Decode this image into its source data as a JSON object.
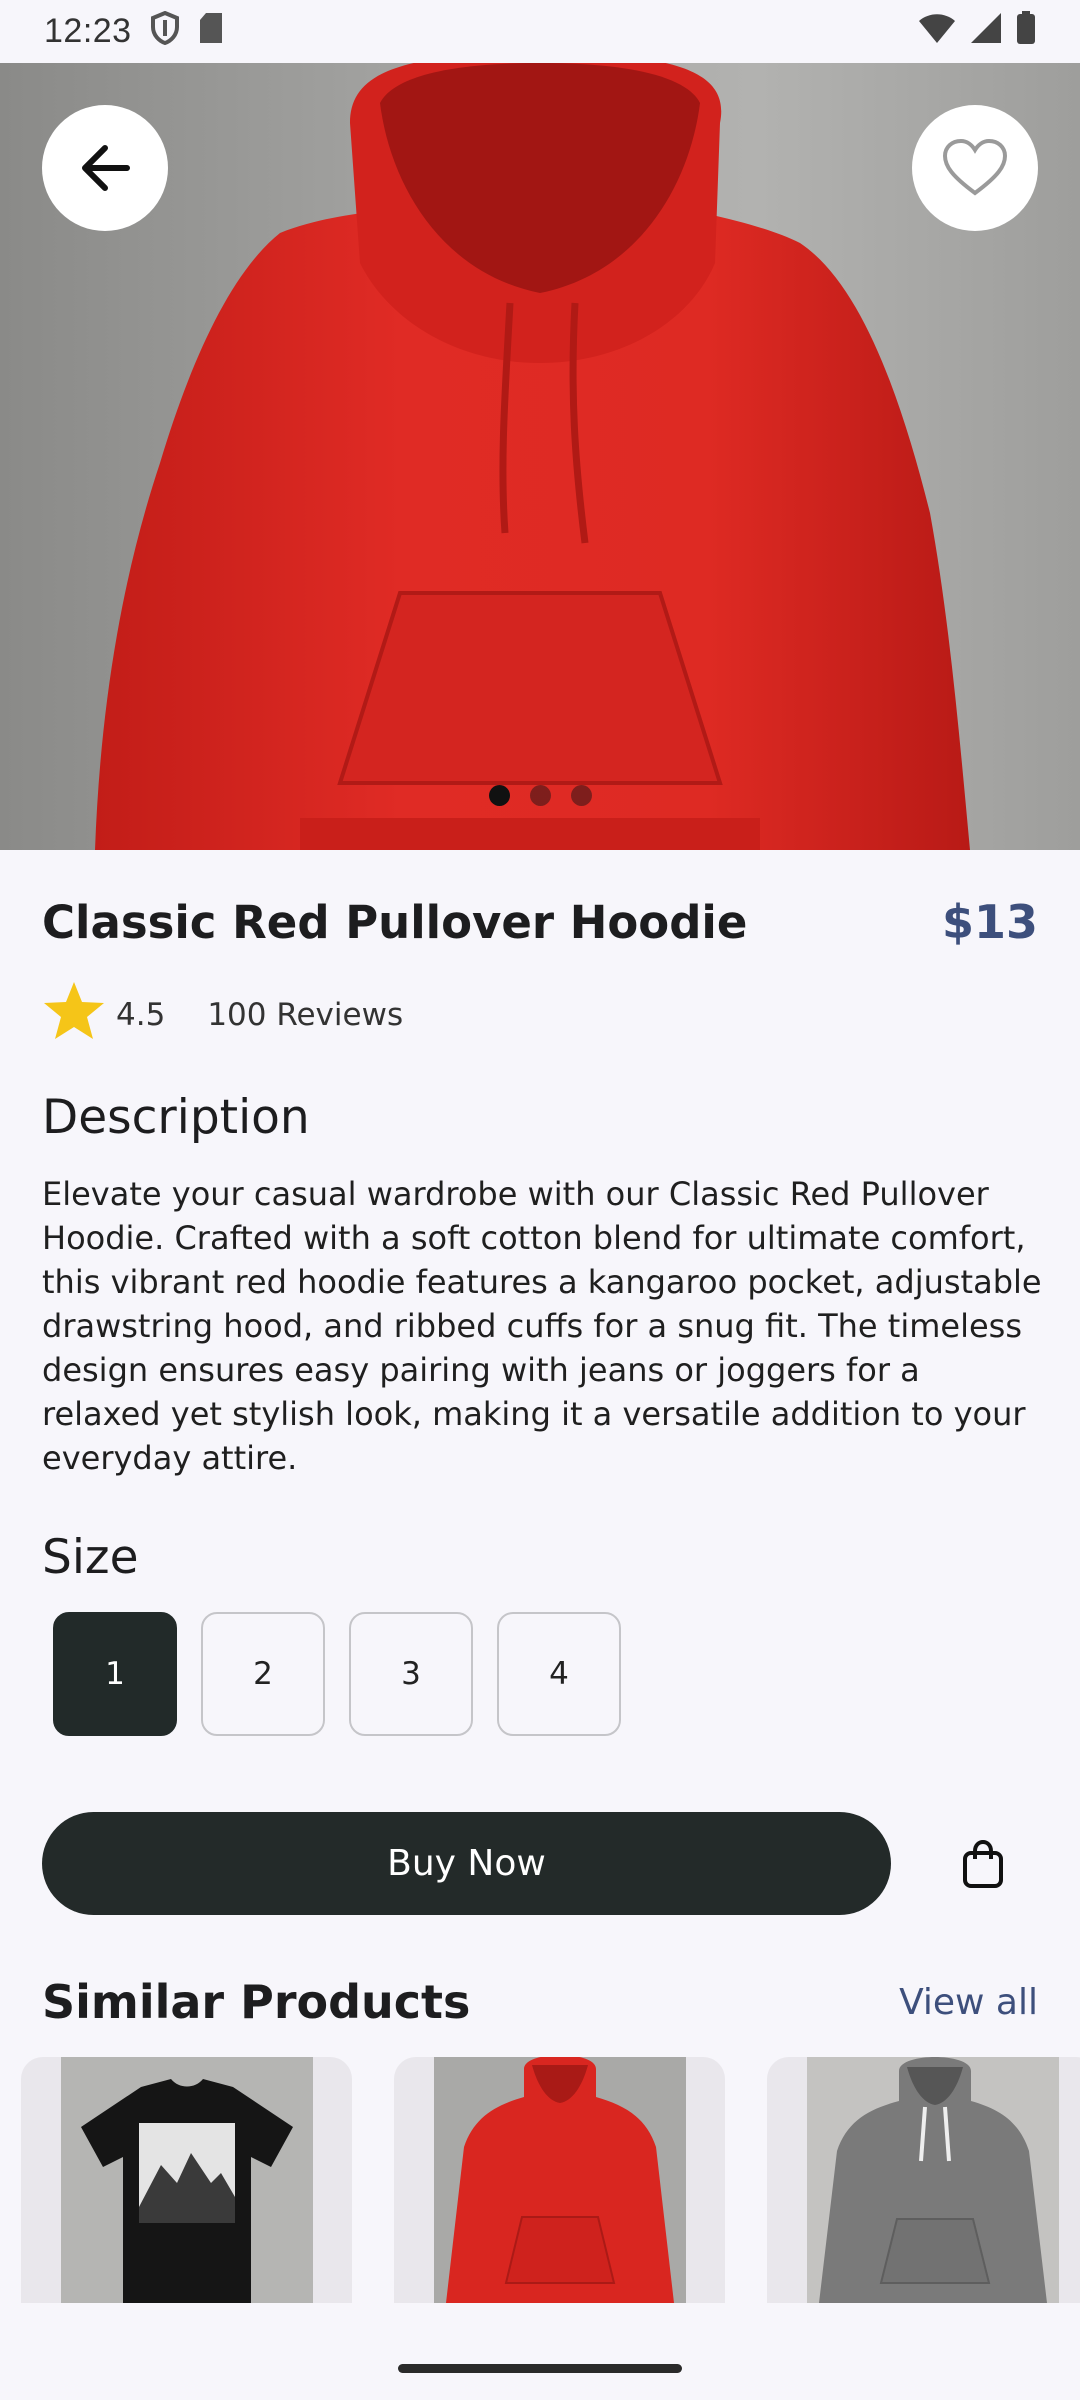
{
  "status_bar": {
    "time": "12:23"
  },
  "product": {
    "title": "Classic Red Pullover Hoodie",
    "price": "$13",
    "rating": "4.5",
    "reviews": "100 Reviews",
    "image_count": 3,
    "active_image_index": 0,
    "primary_color": "#dd2a24"
  },
  "description": {
    "heading": "Description",
    "text": "Elevate your casual wardrobe with our Classic Red Pullover Hoodie. Crafted with a soft cotton blend for ultimate comfort, this vibrant red hoodie features a kangaroo pocket, adjustable drawstring hood, and ribbed cuffs for a snug fit. The timeless design ensures easy pairing with jeans or joggers for a relaxed yet stylish look, making it a versatile addition to your everyday attire."
  },
  "size": {
    "heading": "Size",
    "options": [
      "1",
      "2",
      "3",
      "4"
    ],
    "selected": "1"
  },
  "actions": {
    "buy_label": "Buy Now"
  },
  "similar": {
    "heading": "Similar Products",
    "view_all": "View all",
    "items": [
      {
        "icon": "black-mountain-tshirt-image"
      },
      {
        "icon": "red-hoodie-image"
      },
      {
        "icon": "gray-hoodie-image"
      }
    ]
  },
  "colors": {
    "accent": "#3d4f7c",
    "button_dark": "#232a29",
    "star": "#f5c518"
  }
}
